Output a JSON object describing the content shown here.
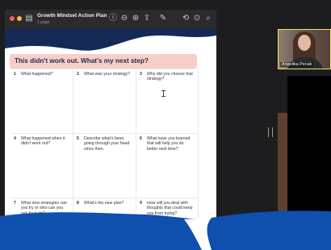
{
  "viewer": {
    "title": "Growth Mindset Action Plan",
    "subtitle": "1 page"
  },
  "worksheet": {
    "heading": "This didn't work out. What's my next step?",
    "cells": [
      {
        "num": "1",
        "text": "What happened?"
      },
      {
        "num": "2",
        "text": "What was your strategy?"
      },
      {
        "num": "3",
        "text": "Why did you choose that strategy?"
      },
      {
        "num": "4",
        "text": "What happened when it didn't work out?"
      },
      {
        "num": "5",
        "text": "Describe what's been going through your head since then."
      },
      {
        "num": "6",
        "text": "What have you learned that will help you do better next time?"
      },
      {
        "num": "7",
        "text": "What new strategies can you try or who can you ask for help?"
      },
      {
        "num": "8",
        "text": "What's the new plan?"
      },
      {
        "num": "9",
        "text": "How will you deal with thoughts that could keep you from trying?"
      }
    ]
  },
  "video": {
    "participant_name": "Angelika Pecak"
  },
  "colors": {
    "header_band": "#f8cfc8",
    "wave": "#142a55",
    "background_blue": "#0f4fae"
  }
}
